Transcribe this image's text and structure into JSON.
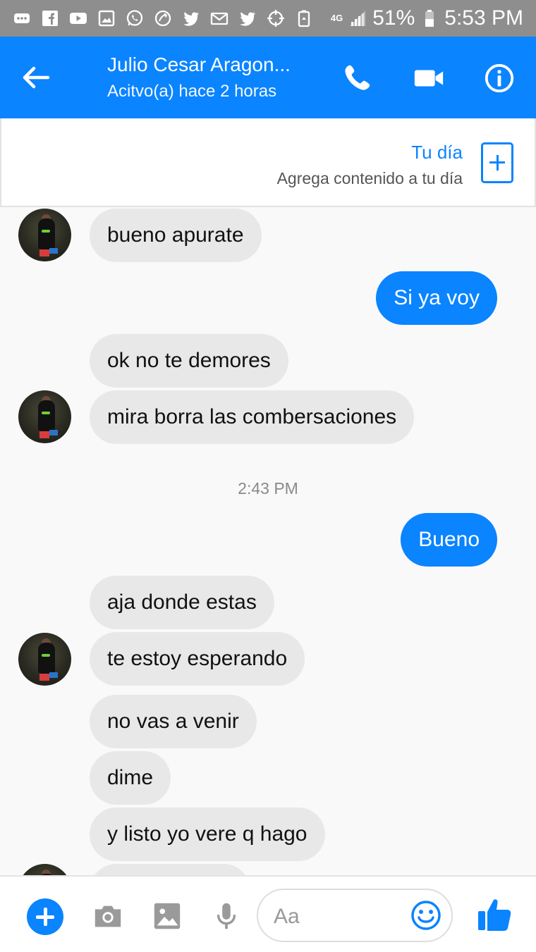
{
  "status_bar": {
    "network": "4G",
    "battery": "51%",
    "time": "5:53 PM"
  },
  "header": {
    "contact_name": "Julio Cesar Aragon...",
    "contact_status": "Acitvo(a) hace 2 horas"
  },
  "story_banner": {
    "title": "Tu día",
    "subtitle": "Agrega contenido a tu día"
  },
  "messages": [
    {
      "from": "them",
      "text": "bueno apurate"
    },
    {
      "from": "me",
      "text": "Si ya voy"
    },
    {
      "from": "them",
      "text": "ok no te demores"
    },
    {
      "from": "them",
      "text": "mira borra las combersaciones"
    },
    {
      "from": "system",
      "text": "2:43 PM"
    },
    {
      "from": "me",
      "text": "Bueno"
    },
    {
      "from": "them",
      "text": "aja donde estas"
    },
    {
      "from": "them",
      "text": "te estoy esperando"
    },
    {
      "from": "them",
      "text": "no vas a venir"
    },
    {
      "from": "them",
      "text": "dime"
    },
    {
      "from": "them",
      "text": "y listo yo vere q hago"
    }
  ],
  "composer": {
    "placeholder": "Aa"
  },
  "colors": {
    "accent": "#0a84ff",
    "incoming_bubble": "#e8e8e8",
    "status_bar": "#8e8e8e"
  },
  "icons": [
    "message-icon",
    "facebook-icon",
    "youtube-icon",
    "gallery-icon",
    "whatsapp-icon",
    "sync-icon",
    "twitter-icon",
    "mail-icon",
    "crosshair-icon",
    "battery-saver-icon",
    "signal-icon",
    "battery-icon",
    "back-arrow-icon",
    "phone-icon",
    "video-camera-icon",
    "info-icon",
    "plus-icon",
    "camera-icon",
    "image-icon",
    "microphone-icon",
    "emoji-icon",
    "thumbs-up-icon"
  ]
}
